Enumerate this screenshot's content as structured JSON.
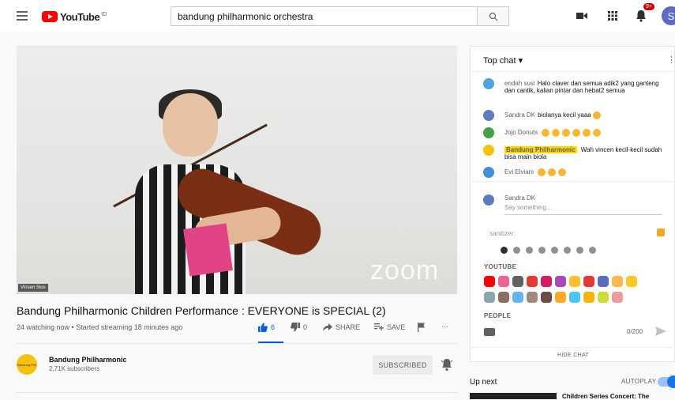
{
  "header": {
    "logo_text": "YouTube",
    "logo_country": "ID",
    "search_value": "bandung philharmonic orchestra",
    "notification_count": "9+",
    "avatar_letter": "S"
  },
  "video": {
    "watermark": "zoom",
    "name_tag": "Vinsen Sius",
    "title": "Bandung Philharmonic Children Performance : EVERYONE is SPECIAL (2)",
    "meta": "24 watching now • Started streaming 18 minutes ago",
    "likes": "6",
    "dislikes": "0",
    "share_label": "SHARE",
    "save_label": "SAVE",
    "more_label": "···"
  },
  "channel": {
    "avatar_text": "Bandung Phil",
    "name": "Bandung Philharmonic",
    "subscribers": "2.71K subscribers",
    "subscribe_label": "SUBSCRIBED"
  },
  "chat": {
    "title": "Top chat ▾",
    "kebab": "⋮",
    "messages": [
      {
        "author": "endah susi",
        "text": "Halo claver dan semua adik2 yang ganteng dan cantik, kalian pintar dan hebat2 semua",
        "avatar_color": "#4fa3e0"
      },
      {
        "author": "Sandra DK",
        "text": "biolanya kecil yaaa",
        "avatar_color": "#5c7cbe"
      },
      {
        "author": "Jojo Donuts",
        "text": "",
        "avatar_color": "#43a047"
      },
      {
        "author": "Bandung Philharmonic",
        "text": "Wah vincen kecil-kecil sudah bisa main biola",
        "avatar_color": "#f4c20d"
      },
      {
        "author": "Evi Elviani",
        "text": "",
        "avatar_color": "#3f8fdb"
      }
    ],
    "compose_name": "Sandra DK",
    "compose_placeholder": "Say something...",
    "sanitizer_text": ":sanitizer:",
    "youtube_section": "YOUTUBE",
    "people_section": "PEOPLE",
    "char_count": "0/200",
    "hide_chat": "HIDE CHAT"
  },
  "up_next": {
    "label": "Up next",
    "autoplay_label": "AUTOPLAY",
    "next_title": "Children Series Concert: The"
  },
  "colors": {
    "brand_red": "#ff0000",
    "like_blue": "#065fd4",
    "owner_yellow": "#ffd600"
  }
}
